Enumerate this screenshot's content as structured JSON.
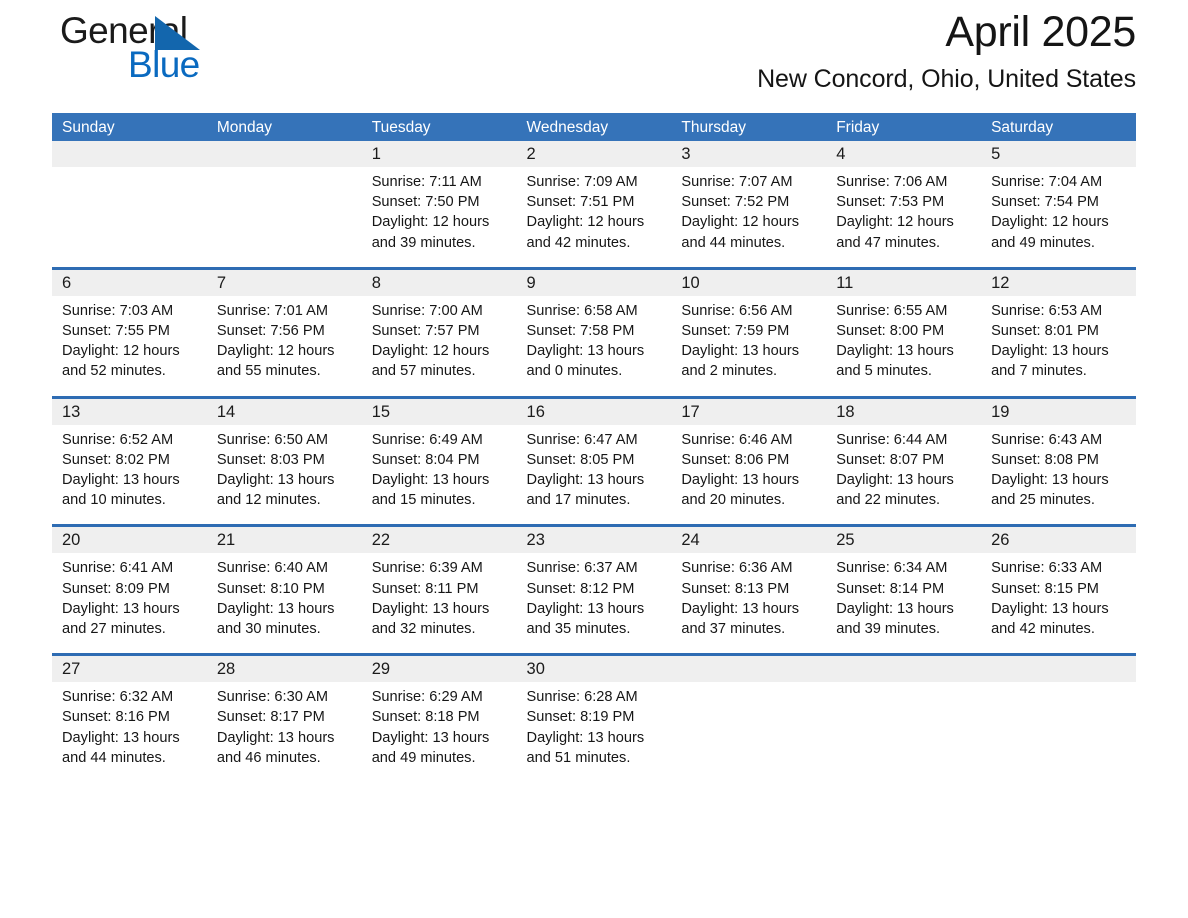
{
  "brand": {
    "name_part1": "General",
    "name_part2": "Blue",
    "logo_icon": "triangle-logo-icon",
    "blue": "#0a6ac0"
  },
  "header": {
    "title": "April 2025",
    "subtitle": "New Concord, Ohio, United States"
  },
  "theme": {
    "header_blue": "#3573b9",
    "row_divider_blue": "#2e6cb3",
    "daynum_gray": "#efefef",
    "text": "#161616"
  },
  "calendar": {
    "day_headers": [
      "Sunday",
      "Monday",
      "Tuesday",
      "Wednesday",
      "Thursday",
      "Friday",
      "Saturday"
    ],
    "weeks": [
      [
        {
          "day": "",
          "info": ""
        },
        {
          "day": "",
          "info": ""
        },
        {
          "day": "1",
          "info": "Sunrise: 7:11 AM\nSunset: 7:50 PM\nDaylight: 12 hours\nand 39 minutes."
        },
        {
          "day": "2",
          "info": "Sunrise: 7:09 AM\nSunset: 7:51 PM\nDaylight: 12 hours\nand 42 minutes."
        },
        {
          "day": "3",
          "info": "Sunrise: 7:07 AM\nSunset: 7:52 PM\nDaylight: 12 hours\nand 44 minutes."
        },
        {
          "day": "4",
          "info": "Sunrise: 7:06 AM\nSunset: 7:53 PM\nDaylight: 12 hours\nand 47 minutes."
        },
        {
          "day": "5",
          "info": "Sunrise: 7:04 AM\nSunset: 7:54 PM\nDaylight: 12 hours\nand 49 minutes."
        }
      ],
      [
        {
          "day": "6",
          "info": "Sunrise: 7:03 AM\nSunset: 7:55 PM\nDaylight: 12 hours\nand 52 minutes."
        },
        {
          "day": "7",
          "info": "Sunrise: 7:01 AM\nSunset: 7:56 PM\nDaylight: 12 hours\nand 55 minutes."
        },
        {
          "day": "8",
          "info": "Sunrise: 7:00 AM\nSunset: 7:57 PM\nDaylight: 12 hours\nand 57 minutes."
        },
        {
          "day": "9",
          "info": "Sunrise: 6:58 AM\nSunset: 7:58 PM\nDaylight: 13 hours\nand 0 minutes."
        },
        {
          "day": "10",
          "info": "Sunrise: 6:56 AM\nSunset: 7:59 PM\nDaylight: 13 hours\nand 2 minutes."
        },
        {
          "day": "11",
          "info": "Sunrise: 6:55 AM\nSunset: 8:00 PM\nDaylight: 13 hours\nand 5 minutes."
        },
        {
          "day": "12",
          "info": "Sunrise: 6:53 AM\nSunset: 8:01 PM\nDaylight: 13 hours\nand 7 minutes."
        }
      ],
      [
        {
          "day": "13",
          "info": "Sunrise: 6:52 AM\nSunset: 8:02 PM\nDaylight: 13 hours\nand 10 minutes."
        },
        {
          "day": "14",
          "info": "Sunrise: 6:50 AM\nSunset: 8:03 PM\nDaylight: 13 hours\nand 12 minutes."
        },
        {
          "day": "15",
          "info": "Sunrise: 6:49 AM\nSunset: 8:04 PM\nDaylight: 13 hours\nand 15 minutes."
        },
        {
          "day": "16",
          "info": "Sunrise: 6:47 AM\nSunset: 8:05 PM\nDaylight: 13 hours\nand 17 minutes."
        },
        {
          "day": "17",
          "info": "Sunrise: 6:46 AM\nSunset: 8:06 PM\nDaylight: 13 hours\nand 20 minutes."
        },
        {
          "day": "18",
          "info": "Sunrise: 6:44 AM\nSunset: 8:07 PM\nDaylight: 13 hours\nand 22 minutes."
        },
        {
          "day": "19",
          "info": "Sunrise: 6:43 AM\nSunset: 8:08 PM\nDaylight: 13 hours\nand 25 minutes."
        }
      ],
      [
        {
          "day": "20",
          "info": "Sunrise: 6:41 AM\nSunset: 8:09 PM\nDaylight: 13 hours\nand 27 minutes."
        },
        {
          "day": "21",
          "info": "Sunrise: 6:40 AM\nSunset: 8:10 PM\nDaylight: 13 hours\nand 30 minutes."
        },
        {
          "day": "22",
          "info": "Sunrise: 6:39 AM\nSunset: 8:11 PM\nDaylight: 13 hours\nand 32 minutes."
        },
        {
          "day": "23",
          "info": "Sunrise: 6:37 AM\nSunset: 8:12 PM\nDaylight: 13 hours\nand 35 minutes."
        },
        {
          "day": "24",
          "info": "Sunrise: 6:36 AM\nSunset: 8:13 PM\nDaylight: 13 hours\nand 37 minutes."
        },
        {
          "day": "25",
          "info": "Sunrise: 6:34 AM\nSunset: 8:14 PM\nDaylight: 13 hours\nand 39 minutes."
        },
        {
          "day": "26",
          "info": "Sunrise: 6:33 AM\nSunset: 8:15 PM\nDaylight: 13 hours\nand 42 minutes."
        }
      ],
      [
        {
          "day": "27",
          "info": "Sunrise: 6:32 AM\nSunset: 8:16 PM\nDaylight: 13 hours\nand 44 minutes."
        },
        {
          "day": "28",
          "info": "Sunrise: 6:30 AM\nSunset: 8:17 PM\nDaylight: 13 hours\nand 46 minutes."
        },
        {
          "day": "29",
          "info": "Sunrise: 6:29 AM\nSunset: 8:18 PM\nDaylight: 13 hours\nand 49 minutes."
        },
        {
          "day": "30",
          "info": "Sunrise: 6:28 AM\nSunset: 8:19 PM\nDaylight: 13 hours\nand 51 minutes."
        },
        {
          "day": "",
          "info": ""
        },
        {
          "day": "",
          "info": ""
        },
        {
          "day": "",
          "info": ""
        }
      ]
    ]
  }
}
